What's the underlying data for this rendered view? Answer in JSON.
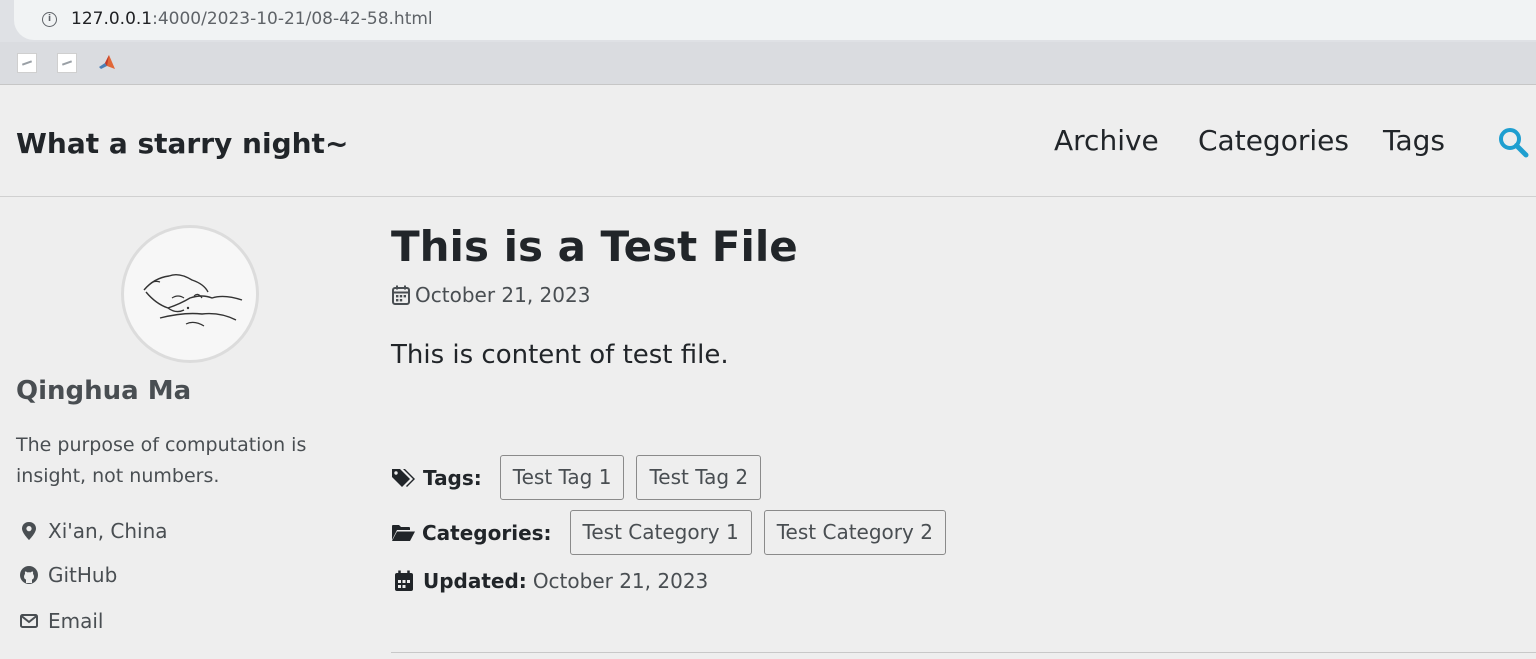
{
  "browser": {
    "url_host": "127.0.0.1",
    "url_rest": ":4000/2023-10-21/08-42-58.html"
  },
  "site": {
    "title": "What a starry night~",
    "nav": [
      "Archive",
      "Categories",
      "Tags"
    ],
    "accent_color": "#1f9fd0"
  },
  "author": {
    "name": "Qinghua Ma",
    "bio": "The purpose of computation is insight, not numbers.",
    "links": [
      {
        "icon": "map-marker-icon",
        "label": "Xi'an, China"
      },
      {
        "icon": "github-icon",
        "label": "GitHub"
      },
      {
        "icon": "envelope-icon",
        "label": "Email"
      }
    ]
  },
  "post": {
    "title": "This is a Test File",
    "date": "October 21, 2023",
    "body": "This is content of test file.",
    "tags_label": "Tags:",
    "tags": [
      "Test Tag 1",
      "Test Tag 2"
    ],
    "categories_label": "Categories:",
    "categories": [
      "Test Category 1",
      "Test Category 2"
    ],
    "updated_label": "Updated:",
    "updated_value": "October 21, 2023"
  }
}
